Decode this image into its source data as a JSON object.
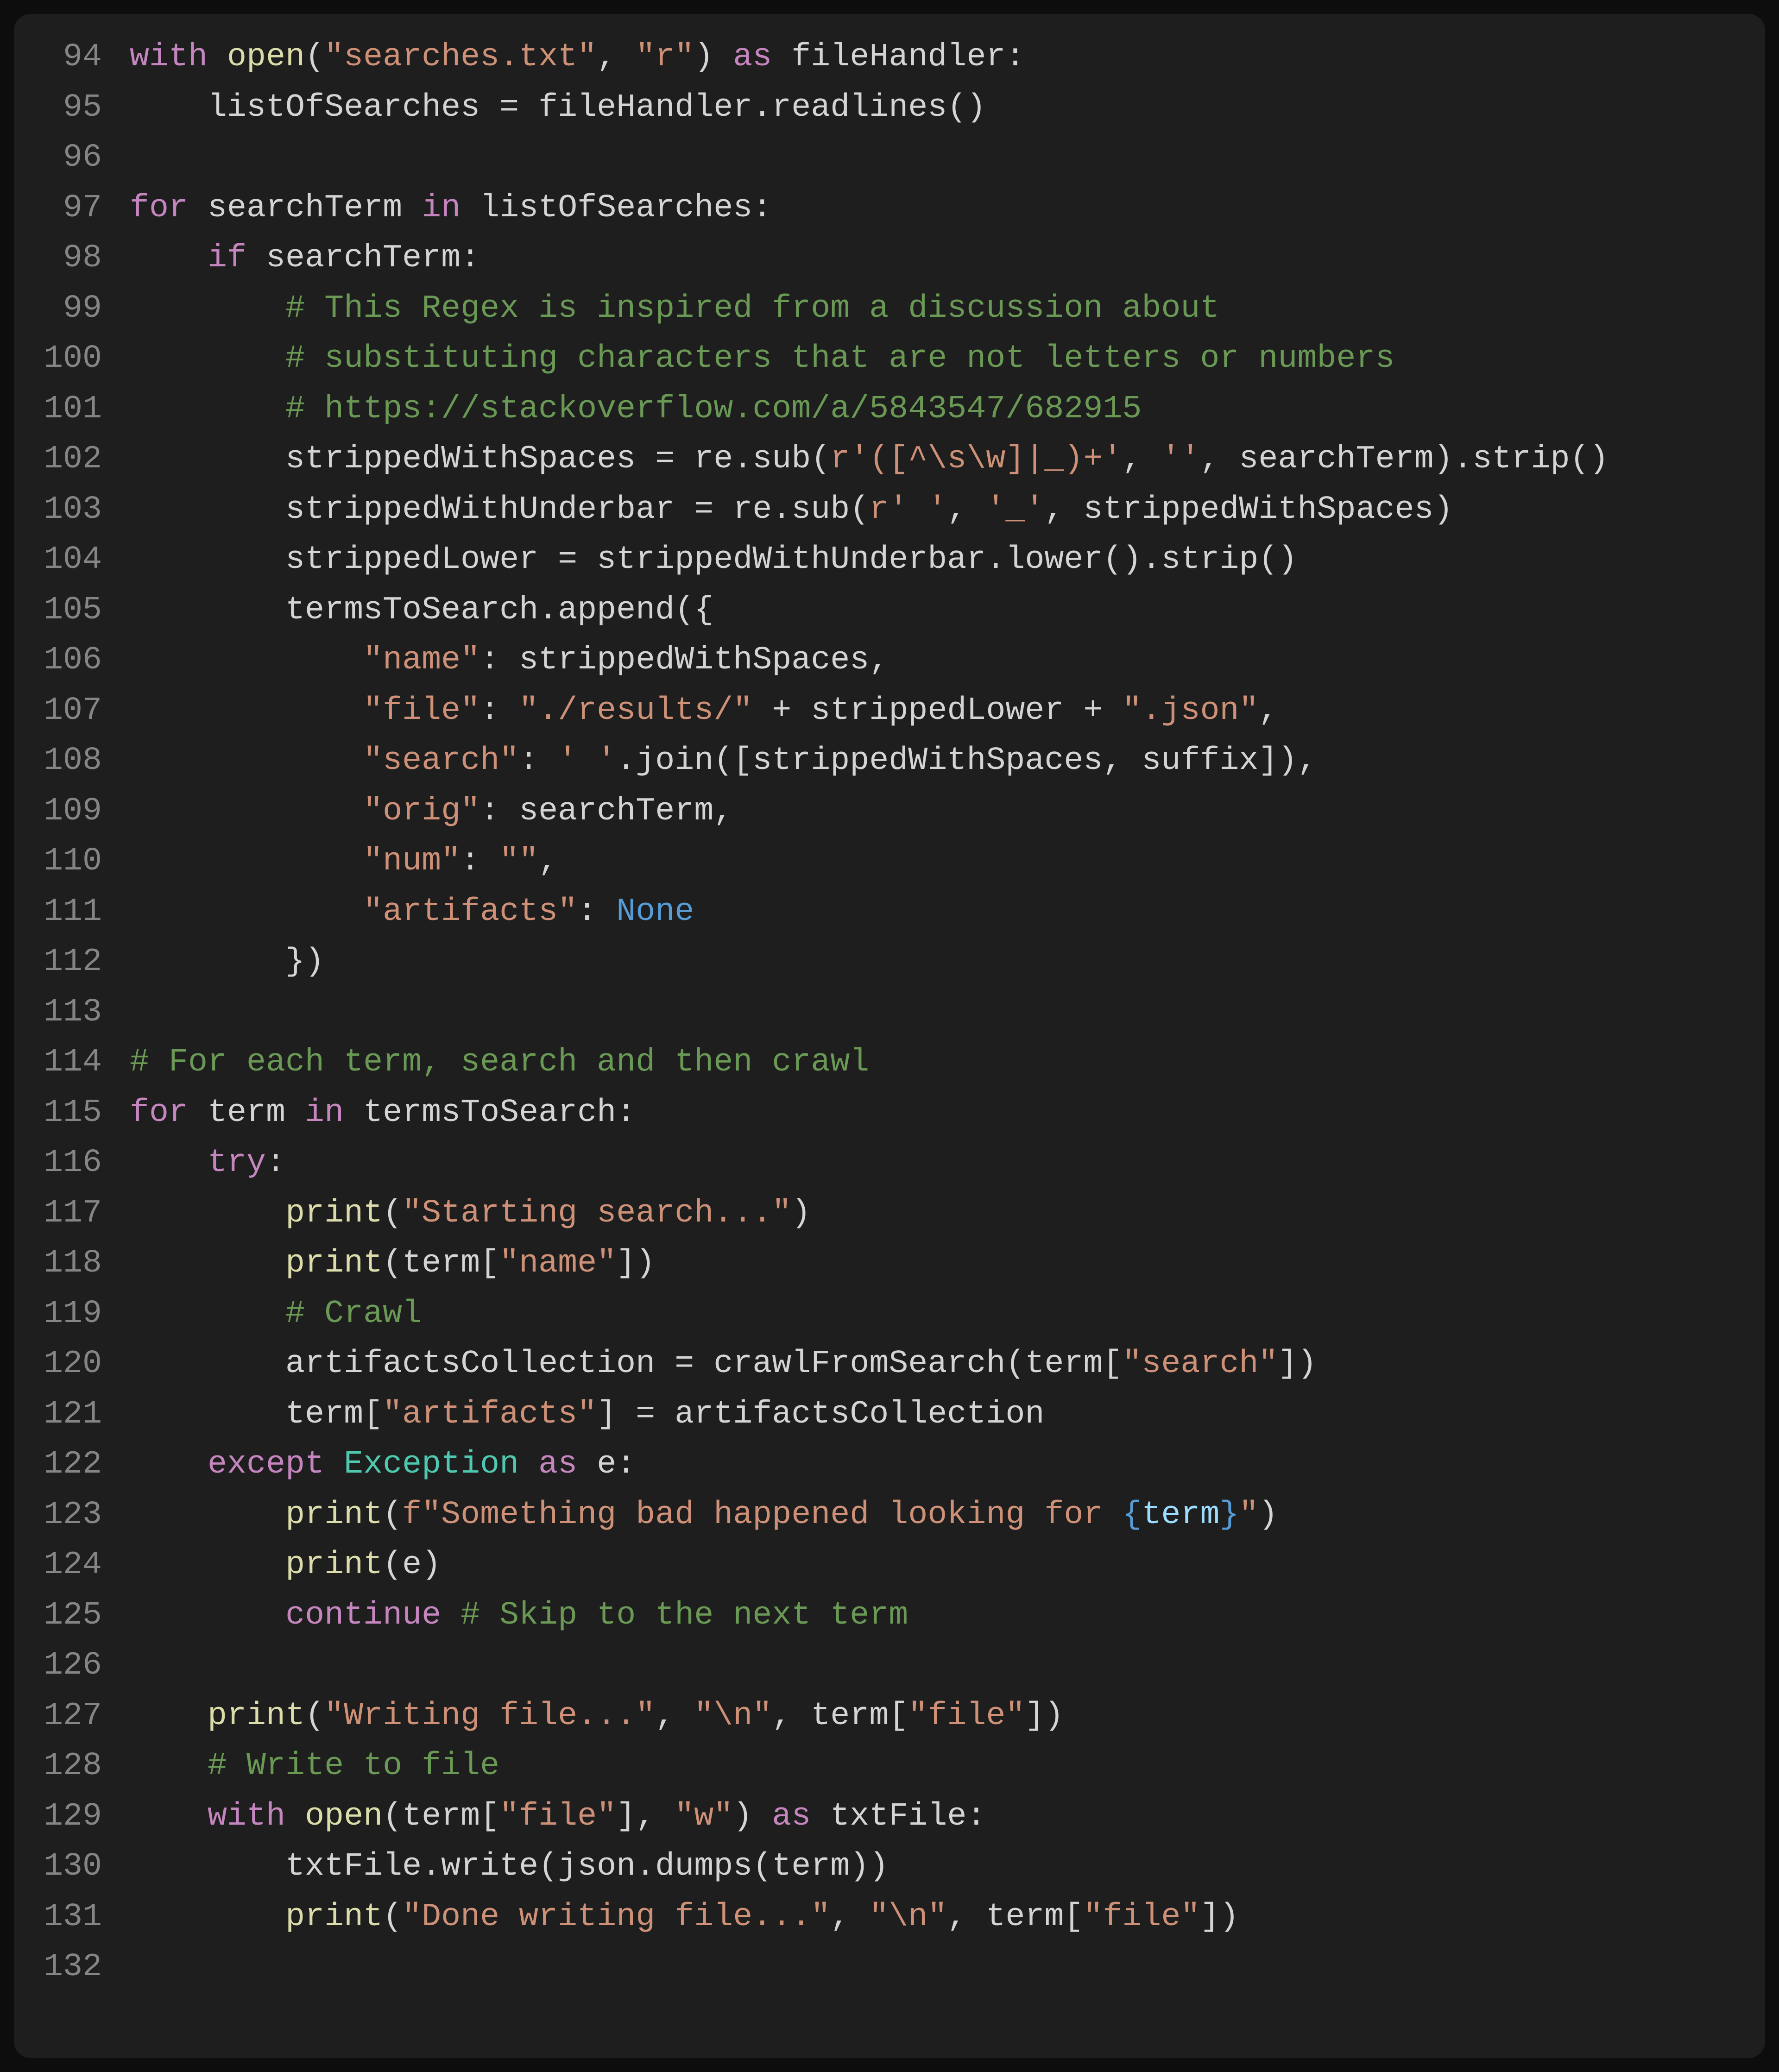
{
  "startLine": 94,
  "lines": [
    [
      [
        "kw",
        "with"
      ],
      [
        "",
        ""
      ],
      [
        "fn",
        " open"
      ],
      [
        "",
        "("
      ],
      [
        "str",
        "\"searches.txt\""
      ],
      [
        "",
        ", "
      ],
      [
        "str",
        "\"r\""
      ],
      [
        "",
        ") "
      ],
      [
        "kw",
        "as"
      ],
      [
        "",
        " fileHandler:"
      ]
    ],
    [
      [
        "",
        "    listOfSearches "
      ],
      [
        "",
        "="
      ],
      [
        "",
        " fileHandler.readlines()"
      ]
    ],
    [
      [
        "",
        ""
      ]
    ],
    [
      [
        "kw",
        "for"
      ],
      [
        "",
        " searchTerm "
      ],
      [
        "kw",
        "in"
      ],
      [
        "",
        " listOfSearches:"
      ]
    ],
    [
      [
        "",
        "    "
      ],
      [
        "kw",
        "if"
      ],
      [
        "",
        " searchTerm:"
      ]
    ],
    [
      [
        "",
        "        "
      ],
      [
        "cm",
        "# This Regex is inspired from a discussion about"
      ]
    ],
    [
      [
        "",
        "        "
      ],
      [
        "cm",
        "# substituting characters that are not letters or numbers"
      ]
    ],
    [
      [
        "",
        "        "
      ],
      [
        "cm",
        "# https://stackoverflow.com/a/5843547/682915"
      ]
    ],
    [
      [
        "",
        "        strippedWithSpaces "
      ],
      [
        "",
        "="
      ],
      [
        "",
        " re.sub("
      ],
      [
        "str",
        "r'([^\\s\\w]|_)+'"
      ],
      [
        "",
        ", "
      ],
      [
        "str",
        "''"
      ],
      [
        "",
        ", searchTerm).strip()"
      ]
    ],
    [
      [
        "",
        "        strippedWithUnderbar "
      ],
      [
        "",
        "="
      ],
      [
        "",
        " re.sub("
      ],
      [
        "str",
        "r' '"
      ],
      [
        "",
        ", "
      ],
      [
        "str",
        "'_'"
      ],
      [
        "",
        ", strippedWithSpaces)"
      ]
    ],
    [
      [
        "",
        "        strippedLower "
      ],
      [
        "",
        "="
      ],
      [
        "",
        " strippedWithUnderbar.lower().strip()"
      ]
    ],
    [
      [
        "",
        "        termsToSearch.append({"
      ]
    ],
    [
      [
        "",
        "            "
      ],
      [
        "str",
        "\"name\""
      ],
      [
        "",
        ": strippedWithSpaces,"
      ]
    ],
    [
      [
        "",
        "            "
      ],
      [
        "str",
        "\"file\""
      ],
      [
        "",
        ": "
      ],
      [
        "str",
        "\"./results/\""
      ],
      [
        "",
        " "
      ],
      [
        "",
        "+"
      ],
      [
        "",
        " strippedLower "
      ],
      [
        "",
        "+"
      ],
      [
        "",
        " "
      ],
      [
        "str",
        "\".json\""
      ],
      [
        "",
        ","
      ]
    ],
    [
      [
        "",
        "            "
      ],
      [
        "str",
        "\"search\""
      ],
      [
        "",
        ": "
      ],
      [
        "str",
        "' '"
      ],
      [
        "",
        ".join([strippedWithSpaces, suffix]),"
      ]
    ],
    [
      [
        "",
        "            "
      ],
      [
        "str",
        "\"orig\""
      ],
      [
        "",
        ": searchTerm,"
      ]
    ],
    [
      [
        "",
        "            "
      ],
      [
        "str",
        "\"num\""
      ],
      [
        "",
        ": "
      ],
      [
        "str",
        "\"\""
      ],
      [
        "",
        ","
      ]
    ],
    [
      [
        "",
        "            "
      ],
      [
        "str",
        "\"artifacts\""
      ],
      [
        "",
        ": "
      ],
      [
        "cn",
        "None"
      ]
    ],
    [
      [
        "",
        "        })"
      ]
    ],
    [
      [
        "",
        ""
      ]
    ],
    [
      [
        "cm",
        "# For each term, search and then crawl"
      ]
    ],
    [
      [
        "kw",
        "for"
      ],
      [
        "",
        " term "
      ],
      [
        "kw",
        "in"
      ],
      [
        "",
        " termsToSearch:"
      ]
    ],
    [
      [
        "",
        "    "
      ],
      [
        "kw",
        "try"
      ],
      [
        "",
        ":"
      ]
    ],
    [
      [
        "",
        "        "
      ],
      [
        "fn",
        "print"
      ],
      [
        "",
        "("
      ],
      [
        "str",
        "\"Starting search...\""
      ],
      [
        "",
        ")"
      ]
    ],
    [
      [
        "",
        "        "
      ],
      [
        "fn",
        "print"
      ],
      [
        "",
        "(term["
      ],
      [
        "str",
        "\"name\""
      ],
      [
        "",
        "])"
      ]
    ],
    [
      [
        "",
        "        "
      ],
      [
        "cm",
        "# Crawl"
      ]
    ],
    [
      [
        "",
        "        artifactsCollection "
      ],
      [
        "",
        "="
      ],
      [
        "",
        " crawlFromSearch(term["
      ],
      [
        "str",
        "\"search\""
      ],
      [
        "",
        "])"
      ]
    ],
    [
      [
        "",
        "        term["
      ],
      [
        "str",
        "\"artifacts\""
      ],
      [
        "",
        "] "
      ],
      [
        "",
        "="
      ],
      [
        "",
        " artifactsCollection"
      ]
    ],
    [
      [
        "",
        "    "
      ],
      [
        "kw",
        "except"
      ],
      [
        "",
        " "
      ],
      [
        "tp",
        "Exception"
      ],
      [
        "",
        " "
      ],
      [
        "kw",
        "as"
      ],
      [
        "",
        " e:"
      ]
    ],
    [
      [
        "",
        "        "
      ],
      [
        "fn",
        "print"
      ],
      [
        "",
        "("
      ],
      [
        "str",
        "f\"Something bad happened looking for "
      ],
      [
        "fbr",
        "{"
      ],
      [
        "var",
        "term"
      ],
      [
        "fbr",
        "}"
      ],
      [
        "str",
        "\""
      ],
      [
        "",
        ")"
      ]
    ],
    [
      [
        "",
        "        "
      ],
      [
        "fn",
        "print"
      ],
      [
        "",
        "(e)"
      ]
    ],
    [
      [
        "",
        "        "
      ],
      [
        "kw",
        "continue"
      ],
      [
        "",
        " "
      ],
      [
        "cm",
        "# Skip to the next term"
      ]
    ],
    [
      [
        "",
        ""
      ]
    ],
    [
      [
        "",
        "    "
      ],
      [
        "fn",
        "print"
      ],
      [
        "",
        "("
      ],
      [
        "str",
        "\"Writing file...\""
      ],
      [
        "",
        ", "
      ],
      [
        "str",
        "\"\\n\""
      ],
      [
        "",
        ", term["
      ],
      [
        "str",
        "\"file\""
      ],
      [
        "",
        "])"
      ]
    ],
    [
      [
        "",
        "    "
      ],
      [
        "cm",
        "# Write to file"
      ]
    ],
    [
      [
        "",
        "    "
      ],
      [
        "kw",
        "with"
      ],
      [
        "",
        " "
      ],
      [
        "fn",
        "open"
      ],
      [
        "",
        "(term["
      ],
      [
        "str",
        "\"file\""
      ],
      [
        "",
        "], "
      ],
      [
        "str",
        "\"w\""
      ],
      [
        "",
        ") "
      ],
      [
        "kw",
        "as"
      ],
      [
        "",
        " txtFile:"
      ]
    ],
    [
      [
        "",
        "        txtFile.write(json.dumps(term))"
      ]
    ],
    [
      [
        "",
        "        "
      ],
      [
        "fn",
        "print"
      ],
      [
        "",
        "("
      ],
      [
        "str",
        "\"Done writing file...\""
      ],
      [
        "",
        ", "
      ],
      [
        "str",
        "\"\\n\""
      ],
      [
        "",
        ", term["
      ],
      [
        "str",
        "\"file\""
      ],
      [
        "",
        "])"
      ]
    ],
    [
      [
        "",
        ""
      ]
    ]
  ]
}
